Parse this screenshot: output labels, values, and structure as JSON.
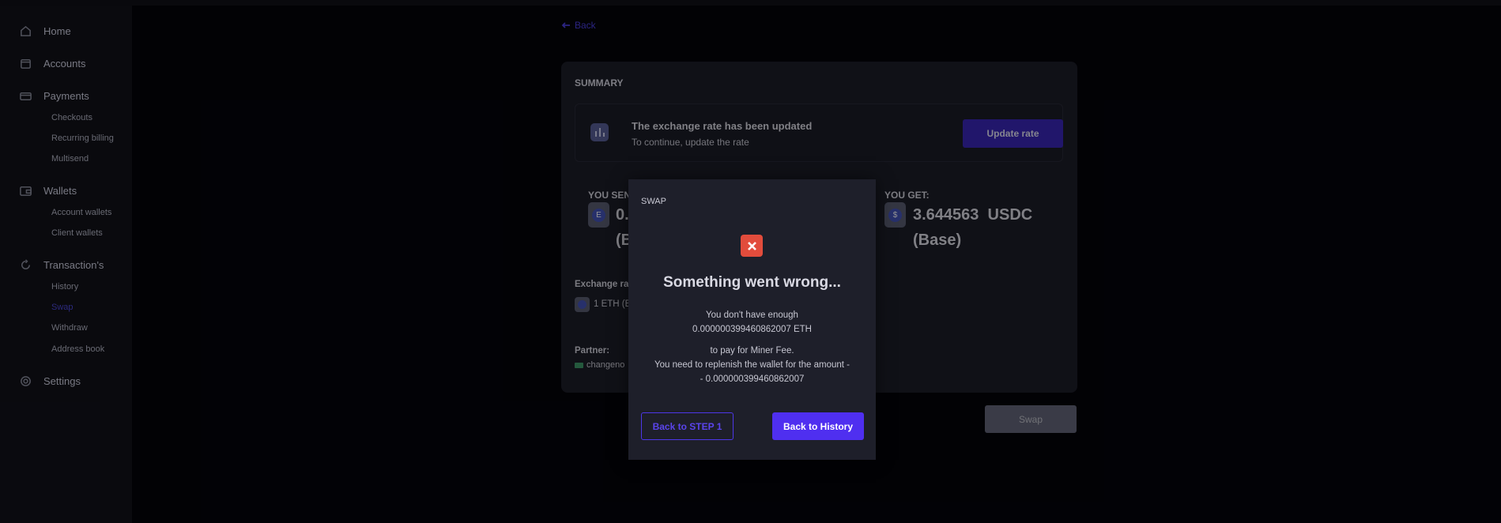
{
  "sidebar": {
    "items": [
      {
        "label": "Home",
        "icon": "home-icon"
      },
      {
        "label": "Accounts",
        "icon": "accounts-icon"
      },
      {
        "label": "Payments",
        "icon": "card-icon",
        "sub": [
          "Checkouts",
          "Recurring billing",
          "Multisend"
        ]
      },
      {
        "label": "Wallets",
        "icon": "wallet-icon",
        "sub": [
          "Account wallets",
          "Client wallets"
        ]
      },
      {
        "label": "Transaction's",
        "icon": "refresh-icon",
        "sub": [
          "History",
          "Swap",
          "Withdraw",
          "Address book"
        ]
      },
      {
        "label": "Settings",
        "icon": "gear-icon"
      }
    ],
    "active_sub": "Swap"
  },
  "main": {
    "back": "Back",
    "summary": {
      "title": "SUMMARY",
      "rate_notice": {
        "title": "The exchange rate has been updated",
        "subtitle": "To continue, update the rate"
      },
      "update_button": "Update rate",
      "you_send": {
        "label": "YOU SEND:",
        "amount_visible": "0.",
        "network_visible": "(B"
      },
      "you_get": {
        "label": "YOU GET:",
        "amount": "3.644563",
        "currency": "USDC",
        "network": "(Base)"
      },
      "exchange_rate": {
        "label": "Exchange rat",
        "value": "1 ETH (B"
      },
      "partner": {
        "label": "Partner:",
        "value": "changeno"
      }
    },
    "swap_button": "Swap"
  },
  "modal": {
    "title": "SWAP",
    "heading": "Something went wrong...",
    "line1": "You don't have enough",
    "line2": "0.000000399460862007 ETH",
    "line3": "to pay for Miner Fee.",
    "line4": "You need to replenish the wallet for the amount -",
    "line5": "- 0.000000399460862007",
    "back_step": "Back to STEP 1",
    "back_history": "Back to History"
  },
  "colors": {
    "accent": "#4f2ff0",
    "error": "#e24c3c",
    "active_nav": "#4c48d8"
  }
}
